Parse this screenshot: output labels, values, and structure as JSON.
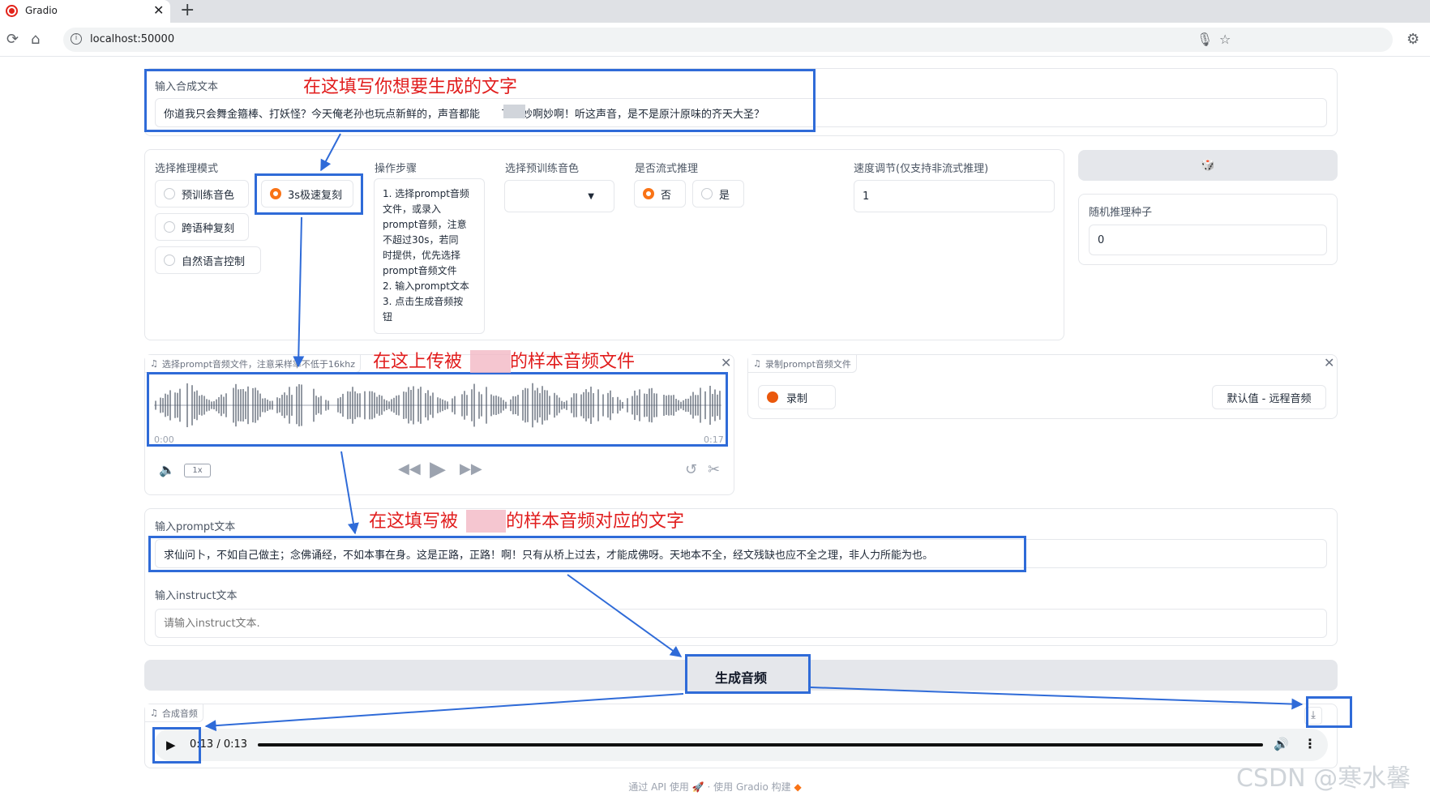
{
  "browser": {
    "tab_title": "Gradio",
    "close_tab": "✕",
    "new_tab": "+",
    "url": "localhost:50000"
  },
  "synth_text": {
    "label": "输入合成文本",
    "value": "你道我只会舞金箍棒、打妖怪？今天俺老孙也玩点新鲜的，声音都能　　了。妙啊妙啊！听这声音，是不是原汁原味的齐天大圣？"
  },
  "mode": {
    "label": "选择推理模式",
    "options": [
      "预训练音色",
      "3s极速复刻",
      "跨语种复刻",
      "自然语言控制"
    ],
    "selected": "3s极速复刻"
  },
  "steps": {
    "label": "操作步骤",
    "lines": [
      "1. 选择prompt音频",
      "文件，或录入",
      "prompt音频，注意",
      "不超过30s，若同",
      "时提供，优先选择",
      "prompt音频文件",
      "2. 输入prompt文本",
      "3. 点击生成音频按",
      "钮"
    ]
  },
  "voice": {
    "label": "选择预训练音色",
    "value": ""
  },
  "stream": {
    "label": "是否流式推理",
    "options": [
      "否",
      "是"
    ],
    "selected": "否"
  },
  "speed": {
    "label": "速度调节(仅支持非流式推理)",
    "value": "1"
  },
  "seed": {
    "button_icon": "🎲",
    "label": "随机推理种子",
    "value": "0"
  },
  "prompt_audio": {
    "label": "选择prompt音频文件，注意采样率不低于16khz",
    "time_start": "0:00",
    "time_end": "0:17",
    "rate": "1x"
  },
  "record": {
    "label": "录制prompt音频文件",
    "record_button": "录制",
    "default_button": "默认值 - 远程音频"
  },
  "prompt_text": {
    "label": "输入prompt文本",
    "value": "求仙问卜，不如自己做主；念佛诵经，不如本事在身。这是正路，正路！啊！只有从桥上过去，才能成佛呀。天地本不全，经文残缺也应不全之理，非人力所能为也。"
  },
  "instruct": {
    "label": "输入instruct文本",
    "placeholder": "请输入instruct文本."
  },
  "generate": {
    "label": "生成音频"
  },
  "output": {
    "label": "合成音频",
    "time": "0:13 / 0:13",
    "progress": 1.0
  },
  "footer": {
    "api": "通过 API 使用",
    "sep": "·",
    "built": "使用 Gradio 构建"
  },
  "annotations": {
    "a1": "在这填写你想要生成的文字",
    "a2_pre": "在这上传被",
    "a2_post": "的样本音频文件",
    "a3_pre": "在这填写被",
    "a3_post": "的样本音频对应的文字"
  },
  "watermark": "CSDN @寒水馨",
  "colors": {
    "accent": "#f97316",
    "annotation_blue": "#2f6bd8",
    "annotation_red": "#e11d1d"
  }
}
